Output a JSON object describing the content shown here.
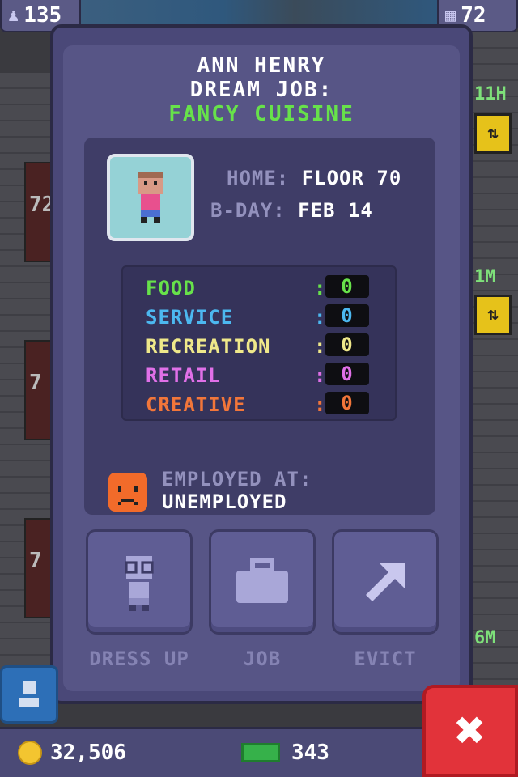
{
  "status": {
    "population": "135",
    "floors": "72"
  },
  "bitizen": {
    "name": "ANN HENRY",
    "dream_job_label": "DREAM JOB:",
    "dream_job": "FANCY CUISINE",
    "home_label": "HOME:",
    "home": "FLOOR 70",
    "bday_label": "B-DAY:",
    "bday": "FEB 14"
  },
  "stats": [
    {
      "label": "FOOD",
      "value": "0",
      "color": "#67e24a"
    },
    {
      "label": "SERVICE",
      "value": "0",
      "color": "#4cb8f0"
    },
    {
      "label": "RECREATION",
      "value": "0",
      "color": "#efe88a"
    },
    {
      "label": "RETAIL",
      "value": "0",
      "color": "#e070e8"
    },
    {
      "label": "CREATIVE",
      "value": "0",
      "color": "#f2763a"
    }
  ],
  "employment": {
    "label": "EMPLOYED AT:",
    "value": "UNEMPLOYED"
  },
  "actions": {
    "dress_up": "DRESS UP",
    "job": "JOB",
    "evict": "EVICT"
  },
  "currency": {
    "coins": "32,506",
    "bux": "343"
  },
  "background": {
    "floor_labels": [
      "11H",
      "1M",
      "6M"
    ],
    "room_labels": [
      "72",
      "7",
      "7"
    ]
  },
  "icons": {
    "population": "person-icon",
    "floors": "building-icon",
    "coins": "coin-icon",
    "bux": "tower-bux-icon",
    "close": "close-x-icon"
  }
}
